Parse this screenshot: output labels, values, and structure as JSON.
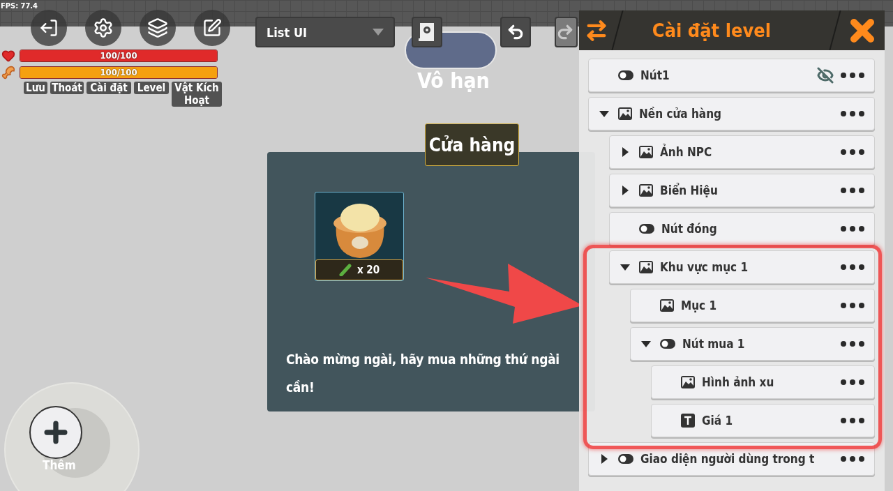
{
  "fps": "FPS: 77.4",
  "tool_buttons": [
    {
      "kind": "exit"
    },
    {
      "kind": "settings"
    },
    {
      "kind": "layers"
    },
    {
      "kind": "trigger"
    }
  ],
  "tool_labels": [
    "Lưu",
    "Thoát",
    "Cài đặt",
    "Level",
    "Vật Kích Hoạt"
  ],
  "stats": [
    {
      "kind": "health",
      "level": 1,
      "reading": "100/100"
    },
    {
      "kind": "hunger",
      "level": 1,
      "reading": "100/100"
    }
  ],
  "scene_select": {
    "value": "List UI"
  },
  "editor_buttons": [
    {
      "kind": "script",
      "disabled": false
    },
    {
      "kind": "undo",
      "disabled": false
    },
    {
      "kind": "redo",
      "disabled": true
    }
  ],
  "loop_selector": {
    "label": "Vô hạn"
  },
  "shop": {
    "title": "Cửa hàng",
    "item": {
      "quantity": "x 20"
    },
    "message": "Chào mừng ngài, hãy mua những thứ ngài cần!"
  },
  "add_button": {
    "label": "Thêm"
  },
  "panel": {
    "title": "Cài đặt level",
    "items": [
      {
        "kind": "button",
        "label": "Nút1",
        "hidden": true
      },
      {
        "kind": "image",
        "label": "Nền cửa hàng",
        "hidden": false,
        "expanded": true,
        "children": [
          {
            "kind": "image",
            "label": "Ảnh NPC",
            "hidden": false,
            "expanded": false
          },
          {
            "kind": "image",
            "label": "Biển Hiệu",
            "hidden": false,
            "expanded": false
          },
          {
            "kind": "button",
            "label": "Nút đóng",
            "hidden": false
          },
          {
            "kind": "image",
            "label": "Khu vực mục 1",
            "hidden": false,
            "expanded": true,
            "children": [
              {
                "kind": "image",
                "label": "Mục 1",
                "hidden": false
              },
              {
                "kind": "button",
                "label": "Nút mua 1",
                "hidden": false,
                "expanded": true,
                "children": [
                  {
                    "kind": "image",
                    "label": "Hình ảnh xu",
                    "hidden": false
                  },
                  {
                    "kind": "text",
                    "label": "Giá 1",
                    "hidden": false
                  }
                ]
              }
            ]
          }
        ]
      },
      {
        "kind": "button",
        "label": "Giao diện người dùng trong t",
        "hidden": false,
        "expanded": false
      }
    ]
  }
}
